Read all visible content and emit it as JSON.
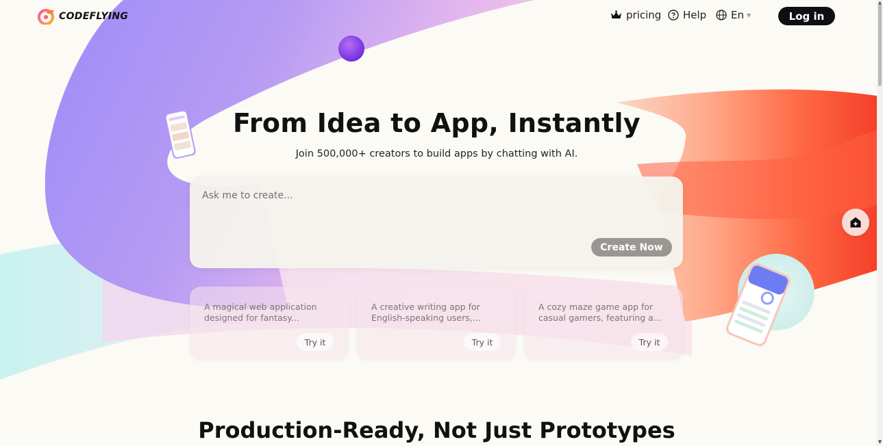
{
  "brand": {
    "name": "CODEFLYING",
    "logo_icon": "codeflying-logo-icon"
  },
  "nav": {
    "pricing_label": "pricing",
    "pricing_icon": "crown-icon",
    "help_label": "Help",
    "help_icon": "question-circle-icon",
    "lang_label": "En",
    "lang_icon": "globe-icon",
    "login_label": "Log in"
  },
  "hero": {
    "title": "From Idea to App, Instantly",
    "subtitle": "Join 500,000+ creators to build apps by chatting with AI.",
    "input_placeholder": "Ask me to create...",
    "create_label": "Create Now"
  },
  "examples": [
    {
      "text": "A magical web application designed for fantasy...",
      "button": "Try it"
    },
    {
      "text": "A creative writing app for English-speaking users,...",
      "button": "Try it"
    },
    {
      "text": "A cozy maze game app for casual gamers, featuring a...",
      "button": "Try it"
    }
  ],
  "section": {
    "title": "Production-Ready, Not Just Prototypes"
  },
  "floating_button_icon": "home-plus-icon",
  "colors": {
    "login_button": "#0f0f12",
    "create_button": "#9a9792",
    "purple_ribbon": "#a38cf7",
    "orange_ribbon": "#ff5a3a",
    "page_bg": "#fbfaf5"
  }
}
